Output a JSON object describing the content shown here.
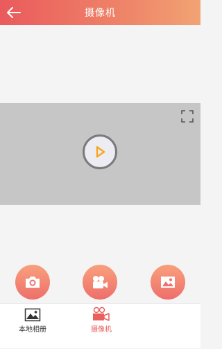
{
  "header": {
    "title": "摄像机",
    "back_icon": "arrow-left-icon"
  },
  "video": {
    "play_icon": "play-icon",
    "fullscreen_icon": "fullscreen-icon"
  },
  "actions": [
    {
      "name": "snapshot",
      "icon": "camera-icon"
    },
    {
      "name": "record",
      "icon": "video-camera-icon"
    },
    {
      "name": "album",
      "icon": "image-icon"
    }
  ],
  "tabs": [
    {
      "label": "本地相册",
      "icon": "gallery-icon",
      "active": false
    },
    {
      "label": "摄像机",
      "icon": "camera-device-icon",
      "active": true
    }
  ],
  "colors": {
    "accent": "#ea5a5c",
    "accent_light": "#f2a374",
    "play_orange": "#f5a623",
    "video_bg": "#c6c6c6"
  }
}
